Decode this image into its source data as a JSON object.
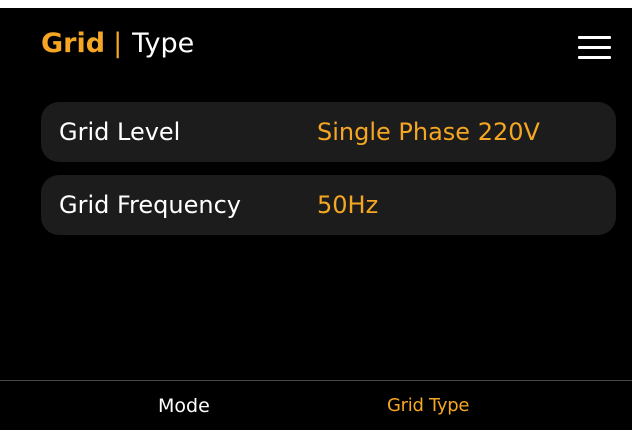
{
  "header": {
    "title_main": "Grid",
    "separator": "|",
    "title_sub": "Type",
    "menu_icon": "hamburger-menu-icon"
  },
  "settings": [
    {
      "label": "Grid Level",
      "value": "Single Phase 220V"
    },
    {
      "label": "Grid Frequency",
      "value": "50Hz"
    }
  ],
  "bottom_nav": {
    "items": [
      {
        "label": "Mode",
        "active": false
      },
      {
        "label": "Grid Type",
        "active": true
      }
    ]
  },
  "colors": {
    "accent": "#f5a623",
    "background": "#000000",
    "row_background": "#1c1c1c",
    "text": "#ffffff"
  }
}
